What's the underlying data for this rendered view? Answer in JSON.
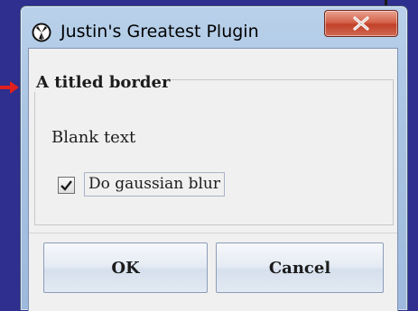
{
  "window": {
    "title": "Justin's Greatest Plugin",
    "close_symbol": "×"
  },
  "group": {
    "title": "A titled border",
    "blank_text": "Blank text",
    "checkbox_label": "Do gaussian blur",
    "checkbox_checked": true
  },
  "buttons": {
    "ok": "OK",
    "cancel": "Cancel"
  },
  "icons": {
    "app": "app-icon",
    "close": "close-icon",
    "checkmark": "checkmark-icon",
    "arrow": "red-arrow-icon"
  },
  "colors": {
    "background": "#2e2f8e",
    "close_button": "#c2402a",
    "arrow": "#e0201e"
  }
}
